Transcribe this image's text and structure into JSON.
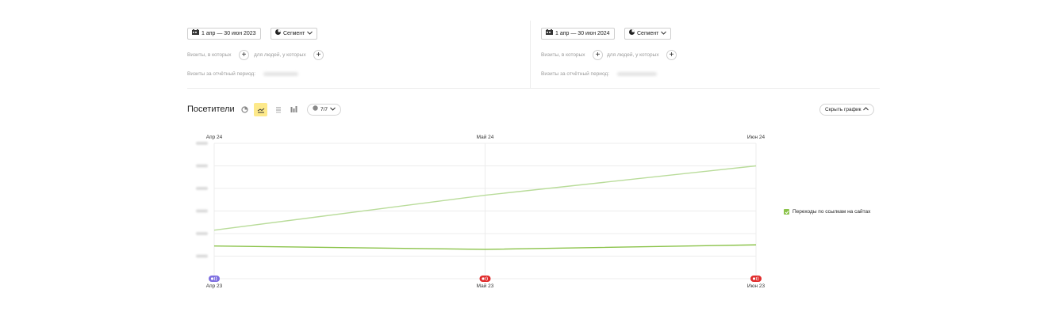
{
  "left_panel": {
    "date_range": "1 апр — 30 июн 2023",
    "segment_label": "Сегмент",
    "visits_which": "Визиты, в которых",
    "for_people": "для людей, у которых",
    "period_label": "Визиты за отчётный период:"
  },
  "right_panel": {
    "date_range": "1 апр — 30 июн 2024",
    "segment_label": "Сегмент",
    "visits_which": "Визиты, в которых",
    "for_people": "для людей, у которых",
    "period_label": "Визиты за отчётный период:"
  },
  "chart_header": {
    "title": "Посетители",
    "series_selector": "7/7",
    "hide_chart": "Скрыть график"
  },
  "colors": {
    "series_2024": "#b9dc9a",
    "series_2023": "#8bc34a",
    "marker_purple": "#7e6fe0",
    "marker_red": "#e02b2b",
    "active_view": "#fde98a"
  },
  "chart_data": {
    "type": "line",
    "x_top": [
      "Апр 24",
      "Май 24",
      "Июн 24"
    ],
    "x_bottom": [
      "Апр 23",
      "Май 23",
      "Июн 23"
    ],
    "series": [
      {
        "name": "",
        "values": [
          2.15,
          3.7,
          5.0
        ]
      },
      {
        "name": "",
        "values": [
          1.45,
          1.3,
          1.5
        ]
      }
    ],
    "ylim": [
      0,
      6
    ],
    "yticks": [
      1,
      2,
      3,
      4,
      5,
      6
    ],
    "grid": true,
    "legend": {
      "position": "right",
      "entries": [
        "Переходы по ссылкам на сайтах"
      ]
    }
  }
}
